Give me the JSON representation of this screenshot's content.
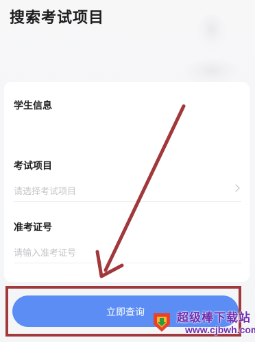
{
  "header": {
    "title": "搜索考试项目"
  },
  "form": {
    "student_info_label": "学生信息",
    "exam_item": {
      "label": "考试项目",
      "placeholder": "请选择考试项目"
    },
    "admission_ticket": {
      "label": "准考证号",
      "placeholder": "请输入准考证号"
    }
  },
  "actions": {
    "submit_label": "立即查询"
  },
  "annotation": {
    "highlight_color": "#a1383b",
    "arrow_color": "#a1383b"
  },
  "watermark": {
    "title": "超级棒下载站",
    "url": "www.cjbwh.com"
  },
  "colors": {
    "button": "#5b8df5",
    "placeholder": "#c4c4c8",
    "background": "#f4f5f7"
  }
}
